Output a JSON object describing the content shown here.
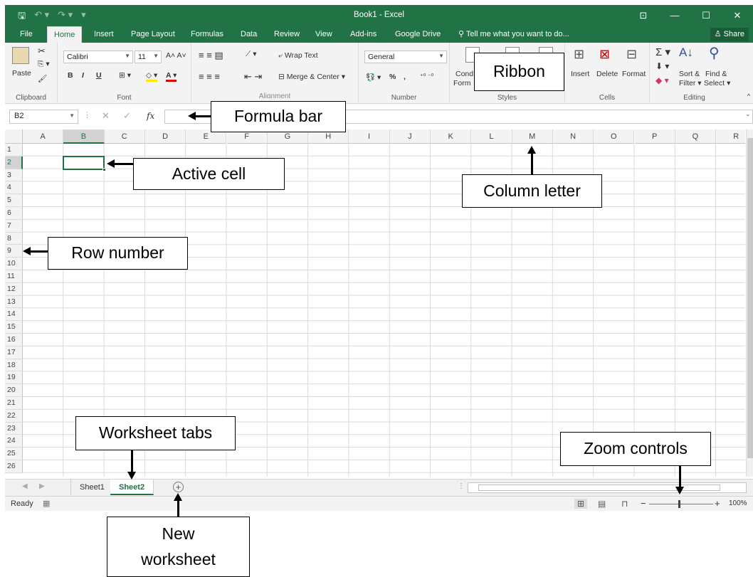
{
  "window": {
    "title": "Book1 - Excel",
    "controls": [
      "ribbon-display",
      "minimize",
      "maximize",
      "close"
    ]
  },
  "quick_access": {
    "save_icon": "save-icon",
    "undo_icon": "undo-icon",
    "redo_icon": "redo-icon",
    "customize_icon": "customize-qat-icon"
  },
  "tabs": [
    {
      "label": "File"
    },
    {
      "label": "Home",
      "active": true
    },
    {
      "label": "Insert"
    },
    {
      "label": "Page Layout"
    },
    {
      "label": "Formulas"
    },
    {
      "label": "Data"
    },
    {
      "label": "Review"
    },
    {
      "label": "View"
    },
    {
      "label": "Add-ins"
    },
    {
      "label": "Google Drive"
    }
  ],
  "tell_me": "Tell me what you want to do...",
  "share_label": "Share",
  "ribbon": {
    "clipboard": {
      "label": "Clipboard",
      "paste": "Paste"
    },
    "font": {
      "label": "Font",
      "family": "Calibri",
      "size": "11",
      "bold": "B",
      "italic": "I",
      "underline": "U"
    },
    "alignment": {
      "label": "Alignment",
      "wrap": "Wrap Text",
      "merge": "Merge & Center"
    },
    "number": {
      "label": "Number",
      "format": "General",
      "percent": "%",
      "comma": ","
    },
    "styles": {
      "label": "Styles",
      "cond_top": "Cond",
      "cond_bottom": "Form"
    },
    "cells": {
      "label": "Cells",
      "insert": "Insert",
      "delete": "Delete",
      "format": "Format"
    },
    "editing": {
      "label": "Editing",
      "sort_top": "Sort &",
      "sort_bottom": "Filter ▾",
      "find_top": "Find &",
      "find_bottom": "Select ▾"
    }
  },
  "formula_bar": {
    "name_box": "B2",
    "fx": "fx",
    "value": ""
  },
  "grid": {
    "columns": [
      "A",
      "B",
      "C",
      "D",
      "E",
      "F",
      "G",
      "H",
      "I",
      "J",
      "K",
      "L",
      "M",
      "N",
      "O",
      "P",
      "Q",
      "R"
    ],
    "rows": [
      "1",
      "2",
      "3",
      "4",
      "5",
      "6",
      "7",
      "8",
      "9",
      "10",
      "11",
      "12",
      "13",
      "14",
      "15",
      "16",
      "17",
      "18",
      "19",
      "20",
      "21",
      "22",
      "23",
      "24",
      "25",
      "26"
    ],
    "active_cell": "B2"
  },
  "sheets": [
    {
      "label": "Sheet1"
    },
    {
      "label": "Sheet2",
      "active": true
    }
  ],
  "status": {
    "ready": "Ready",
    "zoom": "100%"
  },
  "callouts": {
    "ribbon": "Ribbon",
    "formula_bar": "Formula bar",
    "active_cell": "Active cell",
    "column_letter": "Column letter",
    "row_number": "Row number",
    "worksheet_tabs": "Worksheet tabs",
    "zoom_controls": "Zoom controls",
    "new_worksheet_line1": "New",
    "new_worksheet_line2": "worksheet"
  },
  "colors": {
    "excel_green": "#217346",
    "ribbon_bg": "#f3f3f3",
    "grid_line": "#dadada"
  }
}
